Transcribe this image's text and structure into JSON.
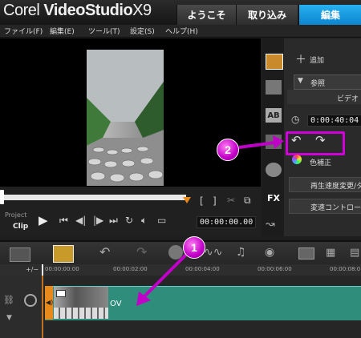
{
  "app": {
    "brand": "Corel",
    "product": "VideoStudio",
    "version": "X9"
  },
  "tabs": [
    {
      "label": "ようこそ",
      "active": false
    },
    {
      "label": "取り込み",
      "active": false
    },
    {
      "label": "編集",
      "active": true
    }
  ],
  "menu": [
    "ファイル(F)",
    "編集(E)",
    "ツール(T)",
    "設定(S)",
    "ヘルプ(H)"
  ],
  "library": {
    "add_label": "追加",
    "browse_label": "参照",
    "video_label": "ビデオ"
  },
  "options": {
    "duration": "0:00:40:04",
    "color_correction": "色補正",
    "speed_change": "再生速度変更/タ-",
    "speed_control": "変速コントロール"
  },
  "player": {
    "project_label": "Project",
    "clip_label": "Clip",
    "timecode": "00:00:00.00"
  },
  "timeline": {
    "ruler": [
      "00:00:00:00",
      "00:00:02:00",
      "00:00:04:00",
      "00:00:06:00",
      "00:00:08:0"
    ],
    "clip_label": "OV"
  },
  "annotations": {
    "badge1": "1",
    "badge2": "2"
  },
  "colors": {
    "accent_tab": "#1ea0e6",
    "highlight": "#d000d8",
    "clip": "#2f8d7c",
    "orange_marker": "#e8891b"
  }
}
